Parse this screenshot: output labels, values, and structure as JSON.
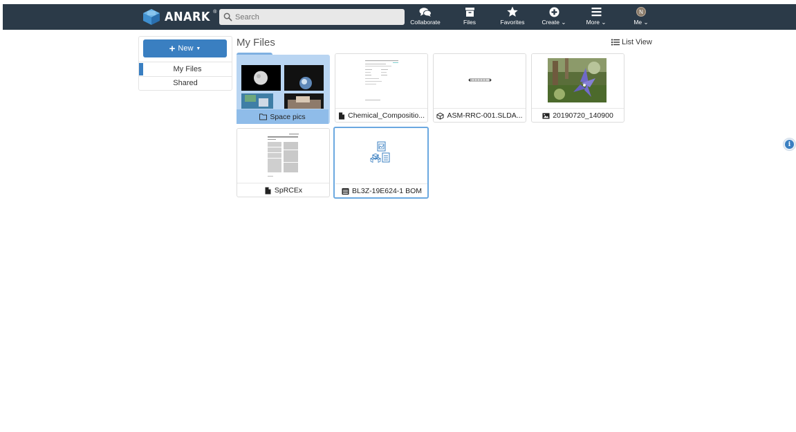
{
  "brand": {
    "name": "ANARK",
    "mark": "®"
  },
  "search": {
    "placeholder": "Search",
    "value": ""
  },
  "nav": [
    {
      "label": "Collaborate",
      "icon": "chat-icon"
    },
    {
      "label": "Files",
      "icon": "files-icon",
      "active": true
    },
    {
      "label": "Favorites",
      "icon": "star-icon"
    },
    {
      "label": "Create",
      "icon": "plus-circle-icon",
      "dropdown": true
    },
    {
      "label": "More",
      "icon": "menu-icon",
      "dropdown": true
    },
    {
      "label": "Me",
      "icon": "avatar",
      "avatar_initial": "N",
      "dropdown": true
    }
  ],
  "sidebar": {
    "new_label": "New",
    "items": [
      {
        "label": "My Files",
        "active": true
      },
      {
        "label": "Shared",
        "active": false
      }
    ]
  },
  "main": {
    "title": "My Files",
    "view_toggle": "List View",
    "items": [
      {
        "name": "Space pics",
        "type": "folder"
      },
      {
        "name": "Chemical_Compositio...",
        "type": "document"
      },
      {
        "name": "ASM-RRC-001.SLDA...",
        "type": "cad"
      },
      {
        "name": "20190720_140900",
        "type": "image"
      },
      {
        "name": "SpRCEx",
        "type": "document"
      },
      {
        "name": "BL3Z-19E624-1 BOM",
        "type": "bom",
        "selected": true
      }
    ]
  },
  "colors": {
    "navbar": "#2b3a48",
    "accent": "#3a7fc1",
    "folder_bg": "#b9d5f2",
    "folder_caption": "#8fbce9",
    "selected_border": "#6aa8e0"
  }
}
